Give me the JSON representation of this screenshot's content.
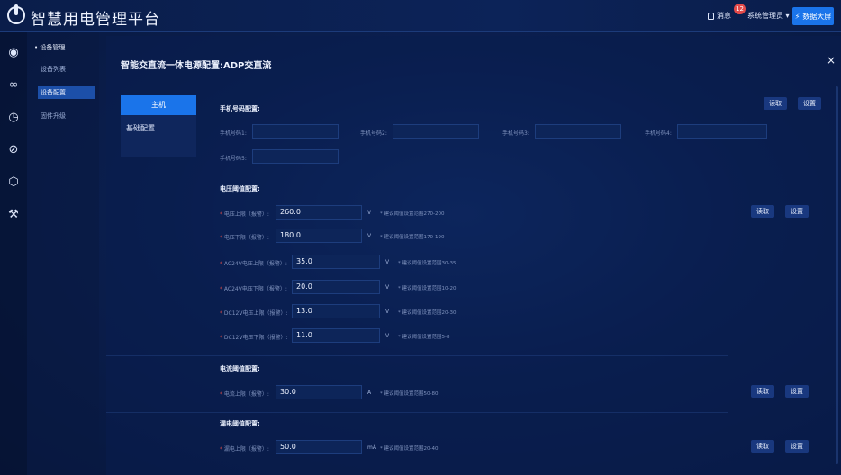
{
  "header": {
    "title": "智慧用电管理平台",
    "message_label": "消息",
    "message_count": "12",
    "user_label": "系统管理员",
    "big_screen_label": "数据大屏"
  },
  "nav": {
    "group": "设备管理",
    "items": [
      {
        "label": "设备列表",
        "active": false
      },
      {
        "label": "设备配置",
        "active": true
      },
      {
        "label": "固件升级",
        "active": false
      }
    ]
  },
  "dialog": {
    "title": "智能交直流一体电源配置:ADP交直流",
    "close": "×",
    "tabs": [
      "主机",
      "基础配置"
    ]
  },
  "buttons": {
    "read": "读取",
    "set": "设置"
  },
  "sections": {
    "phone": {
      "title": "手机号码配置:",
      "fields": [
        "手机号码1:",
        "手机号码2:",
        "手机号码3:",
        "手机号码4:",
        "手机号码5:"
      ]
    },
    "voltage": {
      "title": "电压阈值配置:",
      "rows": [
        {
          "label": "电压上限（报警）:",
          "value": "260.0",
          "unit": "V",
          "hint": "* 建议阈值设置范围270-200"
        },
        {
          "label": "电压下限（报警）:",
          "value": "180.0",
          "unit": "V",
          "hint": "* 建议阈值设置范围170-190"
        },
        {
          "label": "AC24V电压上限（报警）:",
          "value": "35.0",
          "unit": "V",
          "hint": "* 建议阈值设置范围30-35"
        },
        {
          "label": "AC24V电压下限（报警）:",
          "value": "20.0",
          "unit": "V",
          "hint": "* 建议阈值设置范围10-20"
        },
        {
          "label": "DC12V电压上限（报警）:",
          "value": "13.0",
          "unit": "V",
          "hint": "* 建议阈值设置范围20-30"
        },
        {
          "label": "DC12V电压下限（报警）:",
          "value": "11.0",
          "unit": "V",
          "hint": "* 建议阈值设置范围5-8"
        }
      ]
    },
    "current": {
      "title": "电流阈值配置:",
      "row": {
        "label": "电流上限（报警）:",
        "value": "30.0",
        "unit": "A",
        "hint": "* 建议阈值设置范围50-80"
      }
    },
    "leakage": {
      "title": "漏电阈值配置:",
      "row": {
        "label": "漏电上限（报警）:",
        "value": "50.0",
        "unit": "mA",
        "hint": "* 建议阈值设置范围20-40"
      }
    }
  },
  "colors": {
    "accent": "#1a74ea",
    "required": "#d24a4a",
    "badge": "#e24a4a"
  },
  "icons": [
    "signal-icon",
    "link-icon",
    "clock-icon",
    "planet-icon",
    "cube-icon",
    "tools-icon",
    "bolt-icon",
    "bell-icon",
    "chevron-down-icon",
    "close-icon"
  ]
}
